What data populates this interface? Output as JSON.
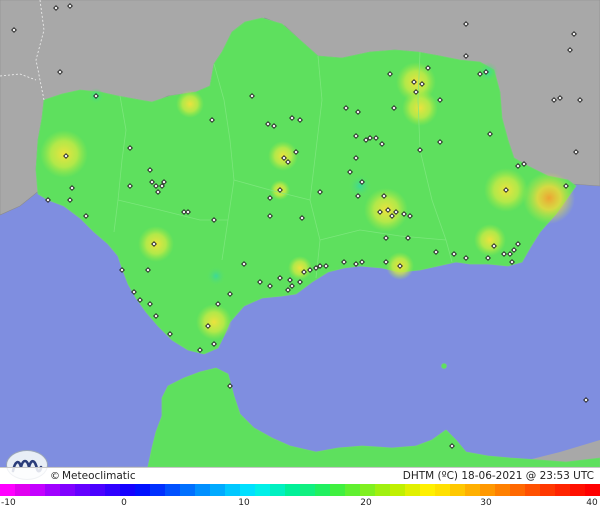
{
  "brand": {
    "symbol": "©",
    "name": "Meteoclimatic"
  },
  "caption": {
    "variable": "DHTM (ºC)",
    "date": "18-06-2021",
    "at": "@",
    "time": "23:53 UTC"
  },
  "scale": {
    "ticks": [
      "-10",
      "0",
      "10",
      "20",
      "30",
      "40"
    ],
    "colors": [
      "#ff00ff",
      "#e000f0",
      "#c400ff",
      "#a000ff",
      "#8000ff",
      "#6400ff",
      "#4a00ff",
      "#3000ff",
      "#1400ff",
      "#0010ff",
      "#0030ff",
      "#0050ff",
      "#0070ff",
      "#0090ff",
      "#00aaff",
      "#00c8ff",
      "#00e0ff",
      "#00f0e8",
      "#00f0c0",
      "#00f098",
      "#10f080",
      "#20f060",
      "#40f040",
      "#60f030",
      "#80f020",
      "#a0f010",
      "#c0f000",
      "#e0f000",
      "#fff000",
      "#ffe000",
      "#ffc800",
      "#ffb000",
      "#ff9800",
      "#ff8000",
      "#ff6800",
      "#ff5000",
      "#ff3800",
      "#ff2400",
      "#ff1000",
      "#ff0000"
    ]
  },
  "colors": {
    "sea": "#7f8ee0",
    "land_outside": "#a8a8a8",
    "land_main": "#5ee05e",
    "warm_spot": "#f4e23c",
    "hot_spot": "#f4a030"
  },
  "hotspots": [
    {
      "t": 32,
      "kind": "hot"
    },
    {
      "t": 30,
      "kind": "warm"
    },
    {
      "t": 29,
      "kind": "warm"
    },
    {
      "t": 28,
      "kind": "warm"
    },
    {
      "t": 27,
      "kind": "warm"
    },
    {
      "t": 26,
      "kind": "warm"
    }
  ]
}
